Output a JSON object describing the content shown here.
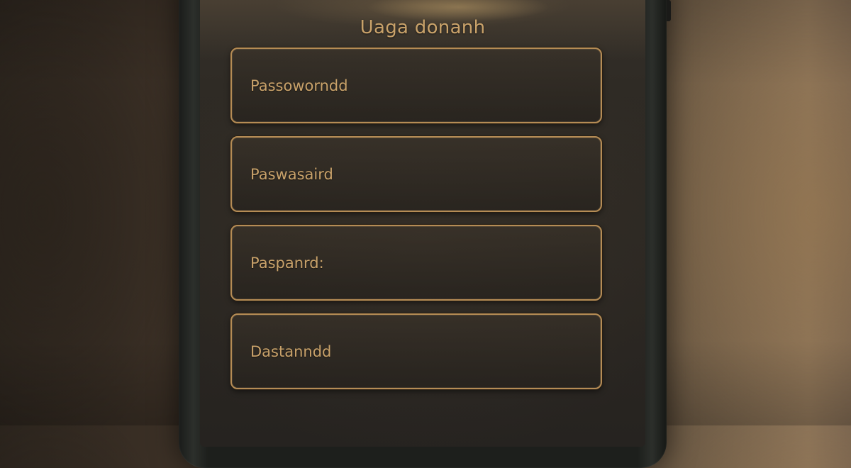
{
  "app": {
    "title": "Uaga donanh"
  },
  "form": {
    "fields": [
      {
        "label": "Passoworndd"
      },
      {
        "label": "Paswasaird"
      },
      {
        "label": "Paspanrd:"
      },
      {
        "label": "Dastanndd"
      }
    ]
  },
  "colors": {
    "accent": "#c9a26a",
    "border": "#b58c55",
    "screen_bg": "#2b2722"
  }
}
